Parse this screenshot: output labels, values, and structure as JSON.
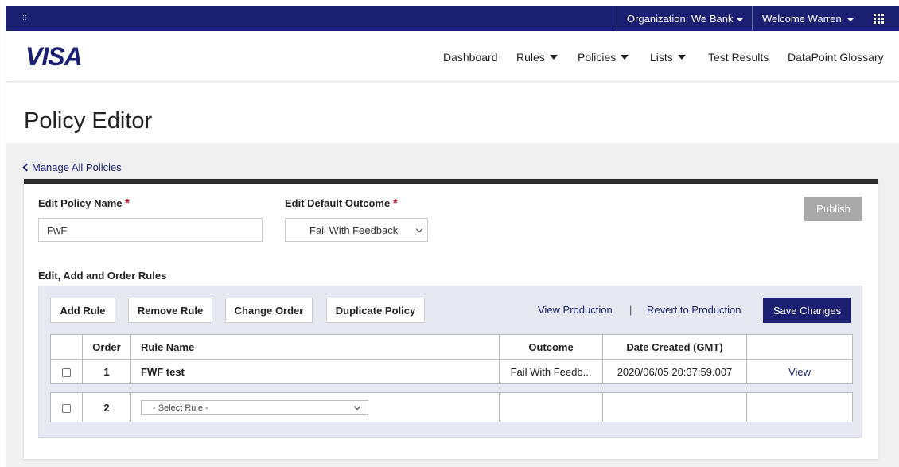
{
  "topbar": {
    "grip_text": "⁞⁞",
    "org_label": "Organization:",
    "org_value": "We Bank",
    "welcome": "Welcome Warren"
  },
  "nav": {
    "logo": "VISA",
    "items": [
      {
        "label": "Dashboard",
        "has_dropdown": false
      },
      {
        "label": "Rules",
        "has_dropdown": true
      },
      {
        "label": "Policies",
        "has_dropdown": true
      },
      {
        "label": "Lists",
        "has_dropdown": true
      },
      {
        "label": "Test Results",
        "has_dropdown": false
      },
      {
        "label": "DataPoint Glossary",
        "has_dropdown": false
      }
    ]
  },
  "page": {
    "title": "Policy Editor",
    "back_link": "Manage All Policies"
  },
  "form": {
    "policy_name_label": "Edit Policy Name",
    "policy_name_value": "FwF",
    "default_outcome_label": "Edit Default Outcome",
    "default_outcome_value": "Fail With Feedback",
    "required_mark": "*",
    "publish_label": "Publish",
    "rules_section_label": "Edit, Add and Order Rules"
  },
  "toolbar": {
    "add_rule": "Add Rule",
    "remove_rule": "Remove Rule",
    "change_order": "Change Order",
    "duplicate_policy": "Duplicate Policy",
    "view_production": "View Production",
    "separator": "|",
    "revert_to_production": "Revert to Production",
    "save_changes": "Save Changes"
  },
  "table": {
    "headers": [
      "",
      "Order",
      "Rule Name",
      "Outcome",
      "Date Created (GMT)",
      ""
    ],
    "rows": [
      {
        "order": "1",
        "rule_name": "FWF test",
        "outcome": "Fail With Feedb...",
        "date_created": "2020/06/05 20:37:59.007",
        "action": "View"
      },
      {
        "order": "2",
        "rule_select": "- Select Rule -",
        "outcome": "",
        "date_created": "",
        "action": ""
      }
    ]
  },
  "colors": {
    "brand_navy": "#1a1f71",
    "required_red": "#c8102e",
    "publish_disabled": "#a9a9a9",
    "panel_bg": "#e7e9f2"
  }
}
